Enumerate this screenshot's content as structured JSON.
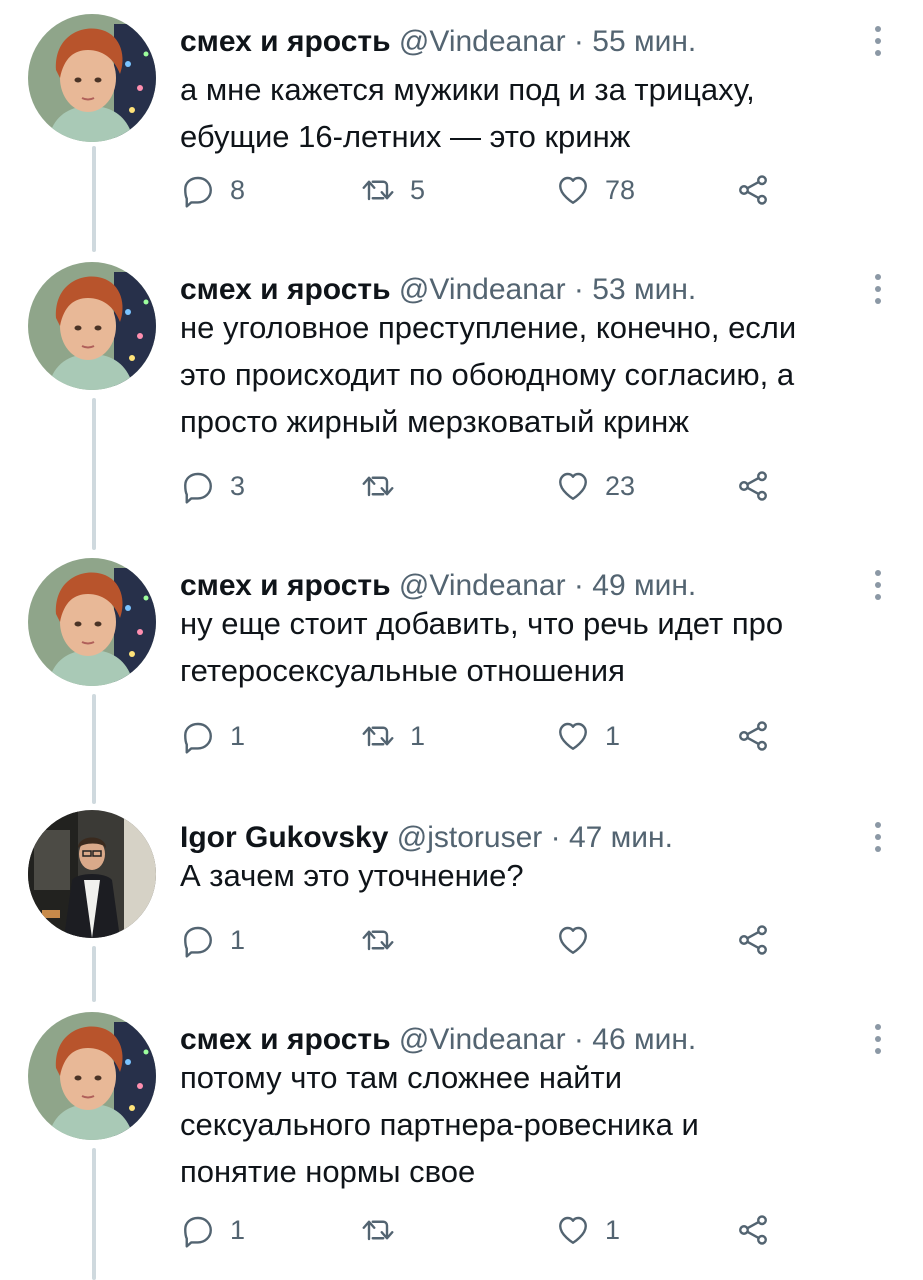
{
  "tweets": [
    {
      "name": "смех и ярость",
      "handle": "@Vindeanar",
      "time": "55 мин.",
      "text": [
        "а мне кажется мужики под и за трицаху,",
        "ебущие 16-летних — это кринж"
      ],
      "replies": "8",
      "retweets": "5",
      "likes": "78",
      "avatar": "redhead-avatar"
    },
    {
      "name": "смех и ярость",
      "handle": "@Vindeanar",
      "time": "53 мин.",
      "text": [
        "не уголовное преступление, конечно, если",
        "это происходит по обоюдному согласию, а",
        "просто жирный мерзковатый кринж"
      ],
      "replies": "3",
      "retweets": "",
      "likes": "23",
      "avatar": "redhead-avatar"
    },
    {
      "name": "смех и ярость",
      "handle": "@Vindeanar",
      "time": "49 мин.",
      "text": [
        "ну еще стоит добавить, что речь идет про",
        "гетеросексуальные отношения"
      ],
      "replies": "1",
      "retweets": "1",
      "likes": "1",
      "avatar": "redhead-avatar"
    },
    {
      "name": "Igor Gukovsky",
      "handle": "@jstoruser",
      "time": "47 мин.",
      "text": [
        "А зачем это уточнение?"
      ],
      "replies": "1",
      "retweets": "",
      "likes": "",
      "avatar": "man-in-suit-avatar"
    },
    {
      "name": "смех и ярость",
      "handle": "@Vindeanar",
      "time": "46 мин.",
      "text": [
        "потому что там сложнее найти",
        "сексуального партнера-ровесника и",
        "понятие нормы свое"
      ],
      "replies": "1",
      "retweets": "",
      "likes": "1",
      "avatar": "redhead-avatar"
    }
  ],
  "separator": "·",
  "icons": [
    "reply-icon",
    "retweet-icon",
    "like-icon",
    "share-icon",
    "more-options-icon"
  ],
  "colors": {
    "text": "#0f1419",
    "secondary": "#536471",
    "thread_line": "#cfd9de"
  }
}
